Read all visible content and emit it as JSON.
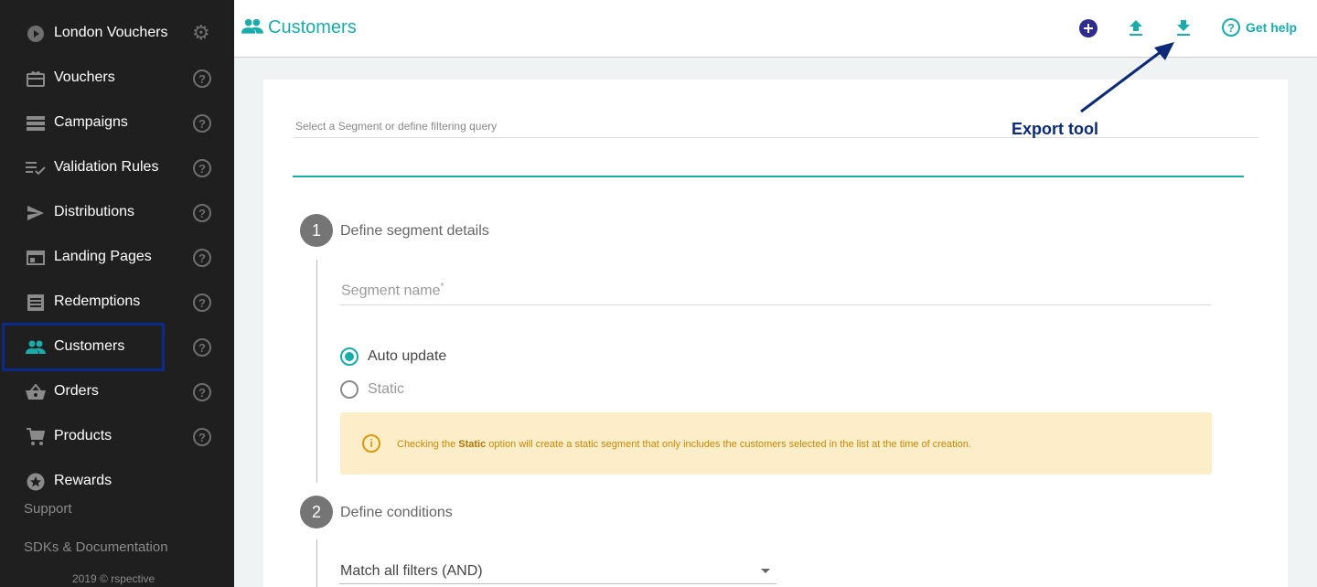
{
  "sidebar": {
    "items": [
      {
        "label": "London Vouchers"
      },
      {
        "label": "Vouchers"
      },
      {
        "label": "Campaigns"
      },
      {
        "label": "Validation Rules"
      },
      {
        "label": "Distributions"
      },
      {
        "label": "Landing Pages"
      },
      {
        "label": "Redemptions"
      },
      {
        "label": "Customers"
      },
      {
        "label": "Orders"
      },
      {
        "label": "Products"
      },
      {
        "label": "Rewards"
      }
    ],
    "support": "Support",
    "sdks": "SDKs & Documentation",
    "copyright": "2019 © rspective"
  },
  "header": {
    "title": "Customers",
    "help_label": "Get help"
  },
  "annotation": {
    "export_label": "Export tool"
  },
  "form": {
    "query_placeholder": "Select a Segment or define filtering query",
    "step1_number": "1",
    "step1_title": "Define segment details",
    "segment_name_label": "Segment name",
    "segment_name_required": "*",
    "auto_update_label": "Auto update",
    "static_label": "Static",
    "selected_option": "Auto update",
    "info_prefix": "Checking the ",
    "info_bold": "Static",
    "info_suffix": " option will create a static segment that only includes the customers selected in the list at the time of creation.",
    "step2_number": "2",
    "step2_title": "Define conditions",
    "match_select_value": "Match all filters (AND)"
  },
  "colors": {
    "accent": "#1aabab",
    "sidebar_bg": "#1f1f1f",
    "annotation": "#0b2a7a",
    "add_button": "#2d2d8f",
    "info_bg": "#fdeec9"
  }
}
